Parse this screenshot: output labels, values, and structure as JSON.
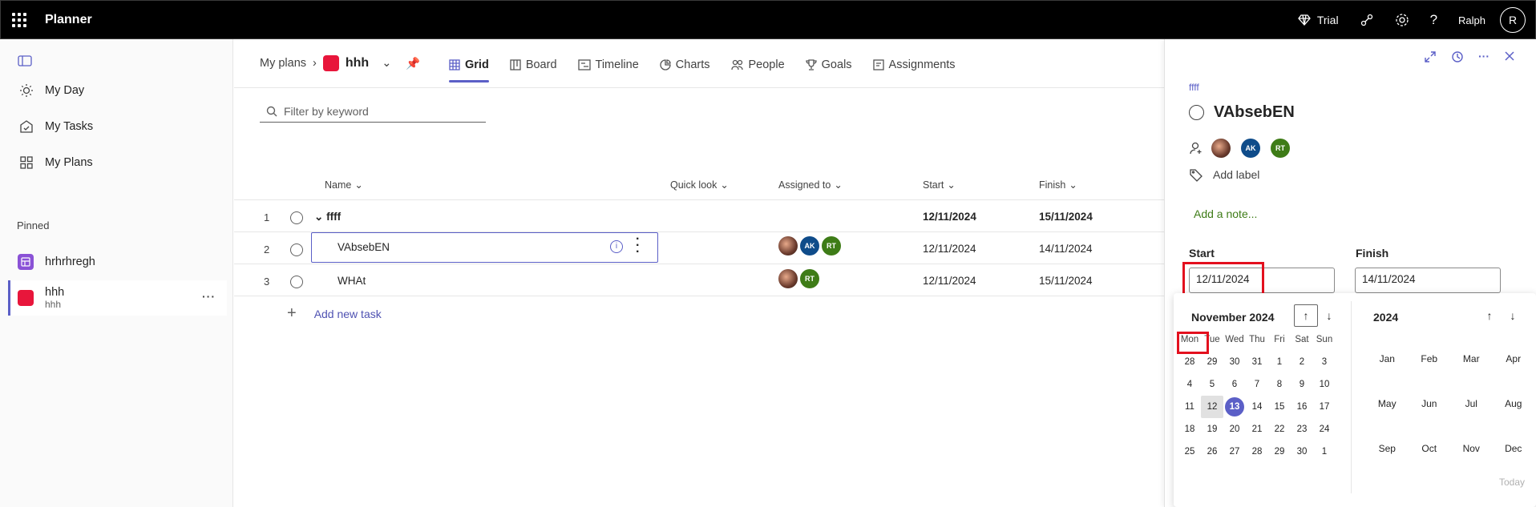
{
  "app": {
    "title": "Planner",
    "trial": "Trial",
    "user": "Ralph",
    "user_initial": "R"
  },
  "sidebar": {
    "items": [
      {
        "label": "My Day",
        "icon": "sun-icon"
      },
      {
        "label": "My Tasks",
        "icon": "tasks-icon"
      },
      {
        "label": "My Plans",
        "icon": "grid-icon"
      }
    ],
    "pinned_label": "Pinned",
    "plans": [
      {
        "name": "hrhrhregh",
        "color": "#8a52d6"
      },
      {
        "name": "hhh",
        "sub": "hhh",
        "color": "#e8163b"
      }
    ]
  },
  "breadcrumb": {
    "root": "My plans",
    "plan": "hhh"
  },
  "tabs": [
    "Grid",
    "Board",
    "Timeline",
    "Charts",
    "People",
    "Goals",
    "Assignments"
  ],
  "filter": {
    "placeholder": "Filter by keyword"
  },
  "grid": {
    "headers": {
      "name": "Name",
      "quick": "Quick look",
      "assigned": "Assigned to",
      "start": "Start",
      "finish": "Finish"
    },
    "rows": [
      {
        "num": "1",
        "name": "ffff",
        "start": "12/11/2024",
        "finish": "15/11/2024"
      },
      {
        "num": "2",
        "name": "VAbsebEN",
        "start": "12/11/2024",
        "finish": "14/11/2024"
      },
      {
        "num": "3",
        "name": "WHAt",
        "start": "12/11/2024",
        "finish": "15/11/2024"
      }
    ],
    "add_task": "Add new task"
  },
  "avatars": {
    "ak": "AK",
    "rt": "RT"
  },
  "panel": {
    "bucket": "ffff",
    "title": "VAbsebEN",
    "add_label": "Add label",
    "add_note": "Add a note...",
    "start_label": "Start",
    "start_value": "12/11/2024",
    "finish_label": "Finish",
    "finish_value": "14/11/2024"
  },
  "calendar": {
    "month": "November 2024",
    "dow": [
      "Mon",
      "Tue",
      "Wed",
      "Thu",
      "Fri",
      "Sat",
      "Sun"
    ],
    "days": [
      "28",
      "29",
      "30",
      "31",
      "1",
      "2",
      "3",
      "4",
      "5",
      "6",
      "7",
      "8",
      "9",
      "10",
      "11",
      "12",
      "13",
      "14",
      "15",
      "16",
      "17",
      "18",
      "19",
      "20",
      "21",
      "22",
      "23",
      "24",
      "25",
      "26",
      "27",
      "28",
      "29",
      "30",
      "1"
    ],
    "selected": "12",
    "today": "13",
    "year": "2024",
    "months": [
      "Jan",
      "Feb",
      "Mar",
      "Apr",
      "May",
      "Jun",
      "Jul",
      "Aug",
      "Sep",
      "Oct",
      "Nov",
      "Dec"
    ],
    "today_link": "Today"
  },
  "colors": {
    "accent": "#5b5fc7",
    "highlight": "#e3101e"
  }
}
